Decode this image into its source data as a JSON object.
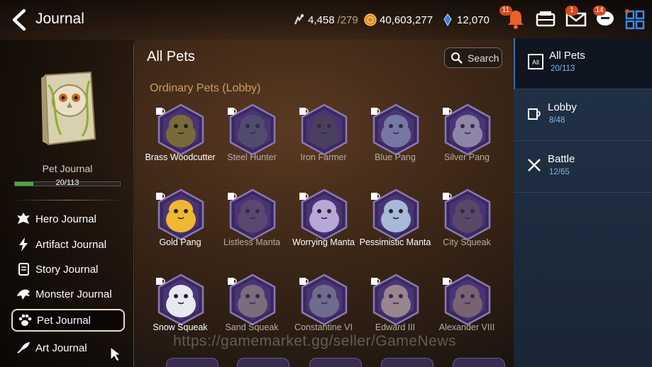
{
  "header": {
    "title": "Journal"
  },
  "resources": {
    "stamina": {
      "value": "4,458",
      "max": "/279"
    },
    "gold": {
      "value": "40,603,277"
    },
    "crystals": {
      "value": "12,070"
    }
  },
  "topicons": {
    "alerts_badge": "11",
    "mail_badge": "1",
    "chat_badge": "14"
  },
  "left": {
    "journal_name": "Pet Journal",
    "progress_text": "20/113",
    "progress_fraction": 0.177,
    "menu": [
      {
        "label": "Hero Journal",
        "icon": "hero-icon"
      },
      {
        "label": "Artifact Journal",
        "icon": "artifact-icon"
      },
      {
        "label": "Story Journal",
        "icon": "story-icon"
      },
      {
        "label": "Monster Journal",
        "icon": "monster-icon"
      },
      {
        "label": "Pet Journal",
        "icon": "paw-icon",
        "active": true
      },
      {
        "label": "Art Journal",
        "icon": "art-icon"
      }
    ]
  },
  "main": {
    "title": "All Pets",
    "search_label": "Search",
    "section": "Ordinary Pets (Lobby)",
    "pets": [
      {
        "name": "Brass Woodcutter",
        "color": "#7a6a3a",
        "dim": false
      },
      {
        "name": "Steel Hunter",
        "color": "#556066",
        "dim": true
      },
      {
        "name": "Iron Farmer",
        "color": "#4a4a4a",
        "dim": true
      },
      {
        "name": "Blue Pang",
        "color": "#9ab0c8",
        "dim": true
      },
      {
        "name": "Silver Pang",
        "color": "#c8c8cc",
        "dim": true
      },
      {
        "name": "Gold Pang",
        "color": "#f0b830",
        "dim": false
      },
      {
        "name": "Listless Manta",
        "color": "#6a5a6a",
        "dim": true
      },
      {
        "name": "Worrying Manta",
        "color": "#b8a8d8",
        "dim": false
      },
      {
        "name": "Pessimistic Manta",
        "color": "#a8b8d8",
        "dim": false
      },
      {
        "name": "City Squeak",
        "color": "#6a5a5a",
        "dim": true
      },
      {
        "name": "Snow Squeak",
        "color": "#e8e8f0",
        "dim": false
      },
      {
        "name": "Sand Squeak",
        "color": "#a89a80",
        "dim": true
      },
      {
        "name": "Constantine VI",
        "color": "#909aa0",
        "dim": true
      },
      {
        "name": "Edward III",
        "color": "#d8c8a0",
        "dim": true
      },
      {
        "name": "Alexander VIII",
        "color": "#a08a70",
        "dim": true
      }
    ]
  },
  "tabs": [
    {
      "label": "All Pets",
      "count": "20/113",
      "icon": "all-icon"
    },
    {
      "label": "Lobby",
      "count": "8/48",
      "icon": "mug-icon"
    },
    {
      "label": "Battle",
      "count": "12/65",
      "icon": "swords-icon"
    }
  ],
  "tab_icon_text": "All",
  "watermark": "https://gamemarket.gg/seller/GameNews"
}
